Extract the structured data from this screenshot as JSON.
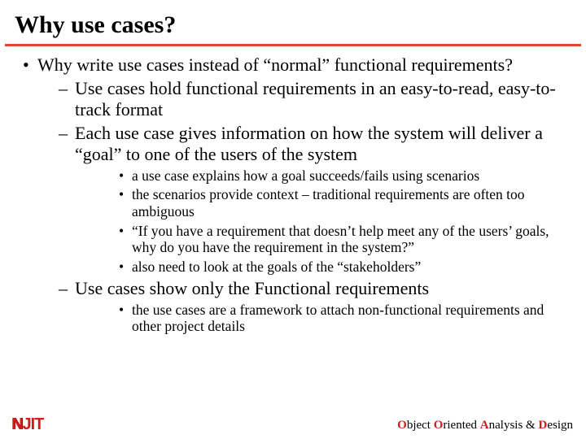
{
  "title": "Why use cases?",
  "bullet1": "Why write use cases instead of “normal” functional requirements?",
  "sub1": "Use cases hold functional requirements in an easy-to-read, easy-to-track format",
  "sub2": "Each use case gives information on how the system will deliver a “goal” to one of the users of the system",
  "subsub1": "a use case explains how a goal succeeds/fails using scenarios",
  "subsub2": "the scenarios provide context – traditional requirements are often too ambiguous",
  "subsub3": "“If you have a requirement that doesn’t help meet any of the users’ goals, why do you have the requirement in the system?”",
  "subsub4": "also need to look at the goals of the “stakeholders”",
  "sub3": "Use cases show only the Functional requirements",
  "subsub5": "the use cases are a framework to attach non-functional requirements and other project details",
  "logo": {
    "n": "N",
    "j": "J",
    "i": "I",
    "t": "T"
  },
  "tagline": {
    "o1": "O",
    "r1": "bject ",
    "o2": "O",
    "r2": "riented ",
    "a": "A",
    "r3": "nalysis & ",
    "d": "D",
    "r4": "esign"
  }
}
